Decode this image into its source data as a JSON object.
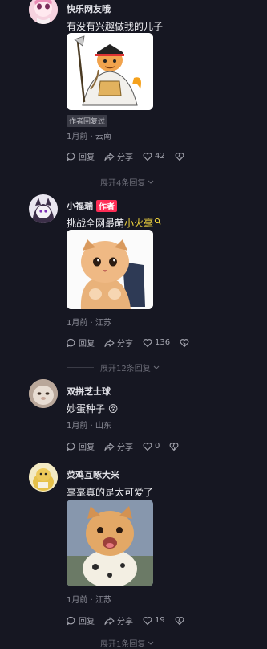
{
  "colors": {
    "background": "#161722",
    "accent": "#fe2c55",
    "highlight": "#f4d73f"
  },
  "comments": [
    {
      "username": "快乐网友哦",
      "text": "有没有兴趣做我的儿子",
      "image": "whitebeard-cat-sticker",
      "tag": "作者回复过",
      "meta": "1月前 · 云南",
      "reply_label": "回复",
      "share_label": "分享",
      "likes": "42",
      "expand": "展开4条回复"
    },
    {
      "username": "小福瑞",
      "author_badge": "作者",
      "text": "挑战全网最萌",
      "text_link": "小火毫",
      "image": "orange-cat-backpack-sticker",
      "meta": "1月前 · 江苏",
      "reply_label": "回复",
      "share_label": "分享",
      "likes": "136",
      "expand": "展开12条回复"
    },
    {
      "username": "双拼芝士球",
      "text": "妙蛋种子 😚",
      "meta": "1月前 · 山东",
      "reply_label": "回复",
      "share_label": "分享",
      "likes": "0"
    },
    {
      "username": "菜鸡互啄大米",
      "text": "毫毫真的是太可爱了",
      "image": "cat-in-penguin-costume-photo",
      "meta": "1月前 · 江苏",
      "reply_label": "回复",
      "share_label": "分享",
      "likes": "19",
      "expand": "展开1条回复"
    }
  ]
}
